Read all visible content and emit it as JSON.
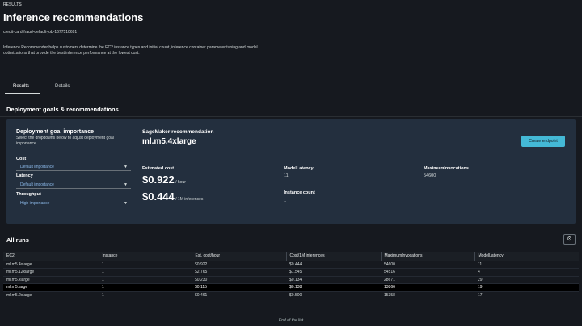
{
  "breadcrumb": "RESULTS",
  "page_title": "Inference recommendations",
  "job_id": "credit-card-fraud-default-job-1677510691",
  "description": "Inference Recommender helps customers determine the EC2 instance types and initial count, inference container parameter tuning and model optimizations that provide the best inference performance at the lowest cost.",
  "tabs": [
    {
      "label": "Results",
      "active": true
    },
    {
      "label": "Details",
      "active": false
    }
  ],
  "deployment": {
    "section_title": "Deployment goals & recommendations",
    "goals_title": "Deployment goal importance",
    "goals_subtitle": "Select the dropdowns below to adjust deployment goal importance.",
    "fields": [
      {
        "label": "Cost",
        "value": "Default importance"
      },
      {
        "label": "Latency",
        "value": "Default importance"
      },
      {
        "label": "Throughput",
        "value": "High importance"
      }
    ],
    "rec_label": "SageMaker recommendation",
    "rec_instance": "ml.m5.4xlarge",
    "create_endpoint_label": "Create endpoint",
    "estimated_cost_label": "Estimated cost",
    "cost_hour": "$0.922",
    "cost_hour_unit": "/ hour",
    "cost_inference": "$0.444",
    "cost_inference_unit": "/ 1M inferences",
    "model_latency_label": "ModelLatency",
    "model_latency": "11",
    "max_invocations_label": "MaximumInvocations",
    "max_invocations": "54600",
    "instance_count_label": "Instance count",
    "instance_count": "1"
  },
  "all_runs": {
    "title": "All runs",
    "columns": [
      "EC2",
      "Instance",
      "Est. cost/hour",
      "Cost/1M inferences",
      "MaximumInvocations",
      "ModelLatency"
    ],
    "rows": [
      [
        "ml.m5.4xlarge",
        "1",
        "$0.922",
        "$0.444",
        "54600",
        "11"
      ],
      [
        "ml.m5.12xlarge",
        "1",
        "$2.765",
        "$1.545",
        "54516",
        "4"
      ],
      [
        "ml.m5.xlarge",
        "1",
        "$0.230",
        "$0.134",
        "28671",
        "29"
      ],
      [
        "ml.m5.large",
        "1",
        "$0.115",
        "$0.138",
        "13866",
        "19"
      ],
      [
        "ml.m5.2xlarge",
        "1",
        "$0.461",
        "$0.500",
        "15358",
        "17"
      ]
    ],
    "selected_row": 3,
    "end_label": "End of the list"
  }
}
